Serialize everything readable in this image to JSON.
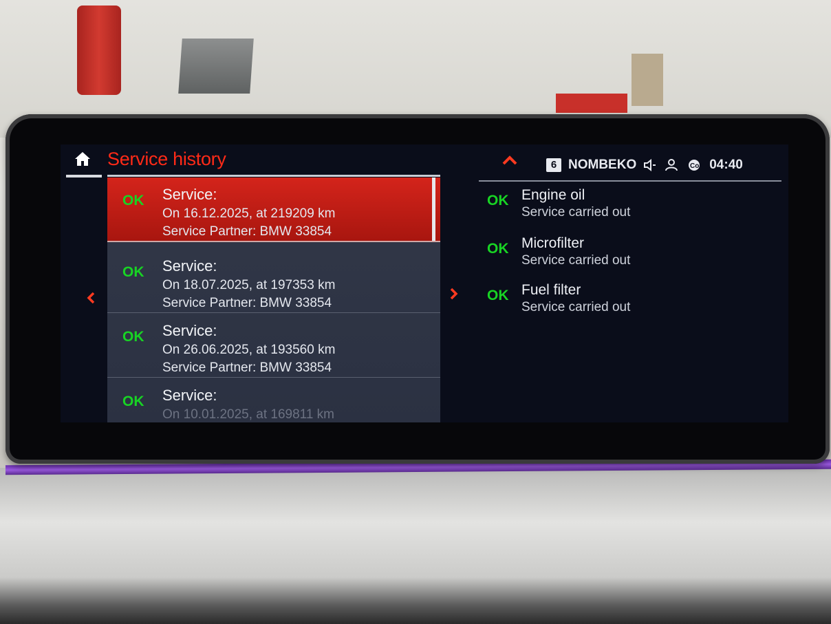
{
  "header": {
    "title": "Service history",
    "radio_preset": "6",
    "station": "NOMBEKO",
    "time": "04:40"
  },
  "history": [
    {
      "status": "OK",
      "heading": "Service:",
      "line1": "On 16.12.2025, at 219209 km",
      "line2": "Service Partner: BMW 33854",
      "selected": true
    },
    {
      "status": "OK",
      "heading": "Service:",
      "line1": "On 18.07.2025, at 197353 km",
      "line2": "Service Partner: BMW 33854",
      "selected": false
    },
    {
      "status": "OK",
      "heading": "Service:",
      "line1": "On 26.06.2025, at 193560 km",
      "line2": "Service Partner: BMW 33854",
      "selected": false
    },
    {
      "status": "OK",
      "heading": "Service:",
      "line1": "On 10.01.2025, at 169811 km",
      "line2": "",
      "selected": false
    }
  ],
  "details": [
    {
      "status": "OK",
      "name": "Engine oil",
      "result": "Service carried out"
    },
    {
      "status": "OK",
      "name": "Microfilter",
      "result": "Service carried out"
    },
    {
      "status": "OK",
      "name": "Fuel filter",
      "result": "Service carried out"
    }
  ],
  "icons": {
    "home": "home-icon",
    "up": "chevron-up-icon",
    "left": "chevron-left-icon",
    "right": "chevron-right-icon",
    "speaker": "speaker-icon",
    "user": "user-icon",
    "connected": "connected-drive-icon"
  },
  "colors": {
    "title_red": "#ff2a17",
    "ok_green": "#18d424",
    "selected_red": "#d4241b",
    "screen_bg": "#0a0d1a"
  }
}
